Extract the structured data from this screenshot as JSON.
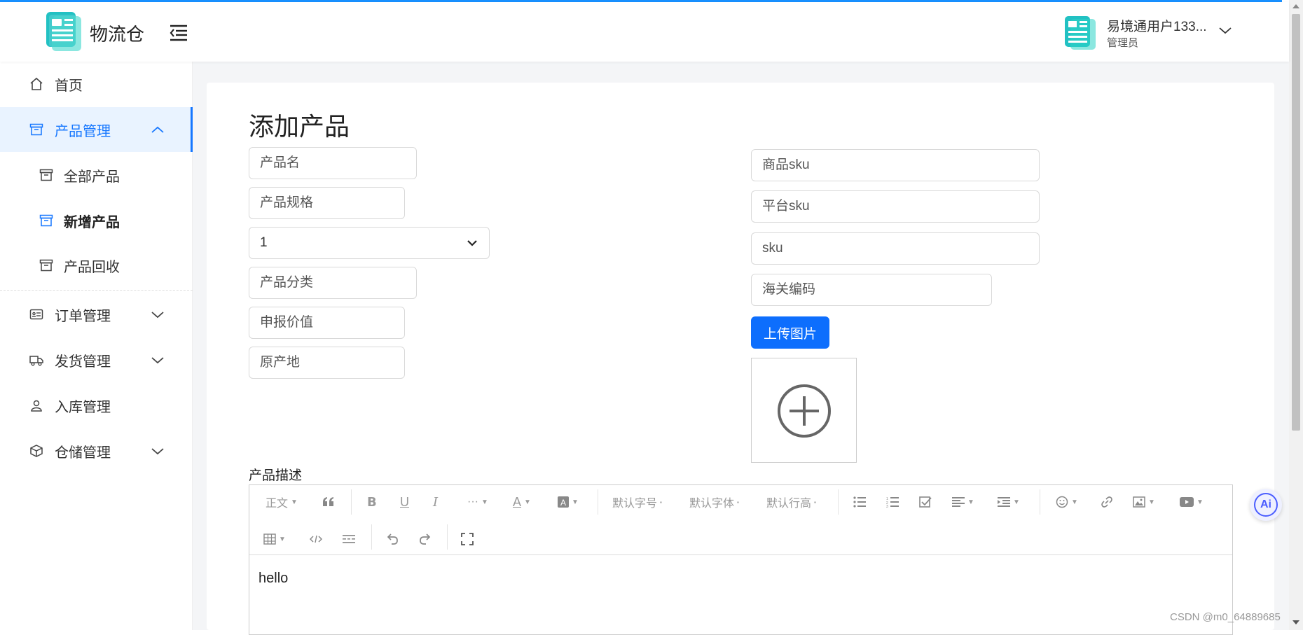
{
  "colors": {
    "accent": "#1677ff",
    "button": "#0d6efd",
    "logo": "#22c1c3"
  },
  "header": {
    "brand": "物流仓",
    "logo_icon": "newspaper-logo",
    "menu_icon": "menu-fold-icon",
    "user": {
      "name": "易境通用户133...",
      "role": "管理员"
    }
  },
  "sidebar": {
    "items": [
      {
        "label": "首页",
        "icon": "home-icon"
      },
      {
        "label": "产品管理",
        "icon": "box-icon",
        "expanded": true
      },
      {
        "label": "全部产品",
        "icon": "box-icon"
      },
      {
        "label": "新增产品",
        "icon": "box-icon",
        "current": true
      },
      {
        "label": "产品回收",
        "icon": "box-icon"
      },
      {
        "label": "订单管理",
        "icon": "id-card-icon"
      },
      {
        "label": "发货管理",
        "icon": "truck-icon"
      },
      {
        "label": "入库管理",
        "icon": "user-icon"
      },
      {
        "label": "仓储管理",
        "icon": "cube-icon"
      }
    ]
  },
  "form": {
    "title": "添加产品",
    "product_name": {
      "placeholder": "产品名",
      "value": ""
    },
    "product_spec": {
      "placeholder": "产品规格",
      "value": ""
    },
    "select_value": "1",
    "category": {
      "placeholder": "产品分类",
      "value": ""
    },
    "declared_value": {
      "placeholder": "申报价值",
      "value": ""
    },
    "origin": {
      "placeholder": "原产地",
      "value": ""
    },
    "goods_sku": {
      "placeholder": "商品sku",
      "value": ""
    },
    "platform_sku": {
      "placeholder": "平台sku",
      "value": ""
    },
    "sku": {
      "placeholder": "sku",
      "value": ""
    },
    "customs_code": {
      "placeholder": "海关编码",
      "value": ""
    },
    "upload_label": "上传图片",
    "description_label": "产品描述"
  },
  "editor": {
    "toolbar": {
      "paragraph": "正文",
      "font_size": "默认字号",
      "font_family": "默认字体",
      "line_height": "默认行高"
    },
    "content": "hello"
  },
  "watermark": "CSDN @m0_64889685",
  "ai_badge": "Ai"
}
